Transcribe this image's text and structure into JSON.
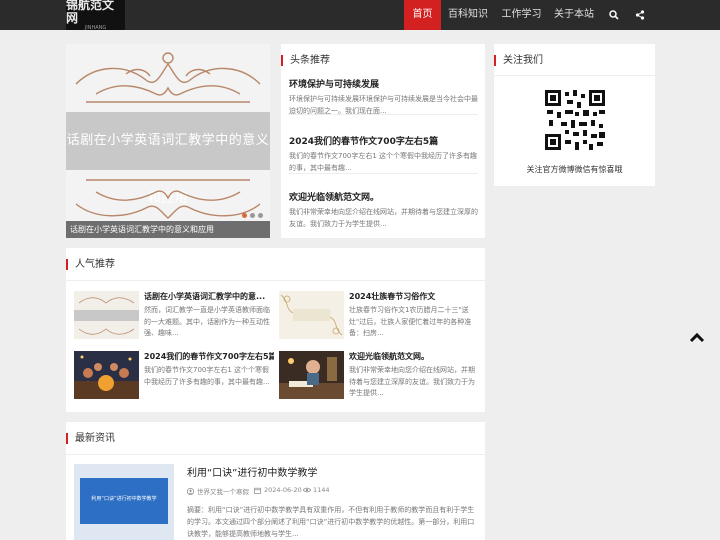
{
  "header": {
    "logo_text": "锦航范文网",
    "logo_sub": "JINHANG",
    "nav": [
      {
        "label": "首页",
        "active": true
      },
      {
        "label": "百科知识",
        "active": false
      },
      {
        "label": "工作学习",
        "active": false
      },
      {
        "label": "关于本站",
        "active": false
      }
    ],
    "search_icon": "search-icon",
    "share_icon": "share-icon"
  },
  "slider": {
    "band_text": "话剧在小学英语词汇教学中的意义和应用",
    "caption": "话剧在小学英语词汇教学中的意义和应用",
    "dots_count": 3
  },
  "headlines": {
    "title": "头条推荐",
    "items": [
      {
        "title": "环境保护与可持续发展",
        "desc": "环境保护与可持续发展环境保护与可持续发展是当今社会中最迫切的问题之一。我们现在面..."
      },
      {
        "title": "2024我们的春节作文700字左右5篇",
        "desc": "我们的春节作文700字左右1 这个个寒假中我经历了许多有趣的事，其中最有趣..."
      },
      {
        "title": "欢迎光临领航范文网。",
        "desc": "我们非常荣幸地向您介绍在线网站，并期待着与您建立深厚的友谊。我们致力于为学生提供..."
      }
    ]
  },
  "follow": {
    "title": "关注我们",
    "caption": "关注官方微博微信有惊喜哦"
  },
  "popular": {
    "title": "人气推荐",
    "items": [
      {
        "title": "话剧在小学英语词汇教学中的意...",
        "desc": "然而，词汇教学一直是小学英语教师面临的一大难题。其中，话剧作为一种互动性强、趣味..."
      },
      {
        "title": "2024壮族春节习俗作文",
        "desc": "壮族春节习俗作文1农历腊月二十三\"送灶\"过后，壮族人家便忙着过年的各种准备：扫房..."
      },
      {
        "title": "2024我们的春节作文700字左右5篇",
        "desc": "我们的春节作文700字左右1 这个个寒假中我经历了许多有趣的事，其中最有趣..."
      },
      {
        "title": "欢迎光临领航范文网。",
        "desc": "我们非常荣幸地向您介绍在线网站，并期待着与您建立深厚的友谊。我们致力于为学生提供..."
      }
    ]
  },
  "latest": {
    "title": "最新资讯",
    "items": [
      {
        "title": "利用“口诀”进行初中数学教学",
        "author": "世界又我一个寒假",
        "date": "2024-06-20",
        "views": "1144",
        "thumb_text": "利用“口诀”进行初中数学教学",
        "desc": "摘要：利用“口诀”进行初中数学教学具有双重作用，不但有利用于教师的教学而且有利于学生的学习。本文通过四个部分阐述了利用“口诀”进行初中数学教学的优越性。第一部分，利用口诀教学，能够提高教师地教与学生..."
      }
    ]
  },
  "colors": {
    "accent": "#d32020",
    "topbar": "#2b2b2b",
    "background": "#eeeeee"
  }
}
